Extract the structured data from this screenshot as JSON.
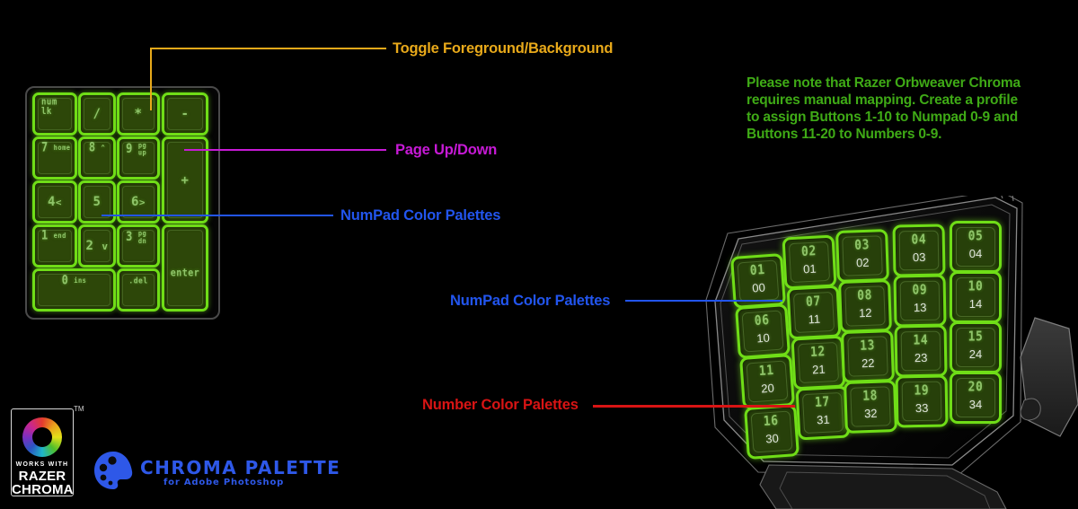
{
  "background": "#000000",
  "note": {
    "color": "#3faa16",
    "lines": [
      "Please note that Razer Orbweaver Chroma",
      "requires manual mapping. Create a profile",
      "to assign Buttons 1-10 to Numpad 0-9 and",
      "Buttons 11-20 to Numbers 0-9."
    ]
  },
  "callouts": [
    {
      "id": "toggle",
      "text": "Toggle Foreground/Background",
      "color": "#e8a91a"
    },
    {
      "id": "pageupdown",
      "text": "Page Up/Down",
      "color": "#c71ad6"
    },
    {
      "id": "numpad_pal",
      "text": "NumPad Color Palettes",
      "color": "#2255ee"
    },
    {
      "id": "numpad_pal2",
      "text": "NumPad Color Palettes",
      "color": "#2255ee"
    },
    {
      "id": "number_pal",
      "text": "Number Color Palettes",
      "color": "#d81414"
    }
  ],
  "numpad": {
    "accent": "#6fdd17",
    "fill": "#2d4709",
    "keys": [
      {
        "id": "numlk",
        "main": "num",
        "sub": "lk",
        "style": "corner2"
      },
      {
        "id": "slash",
        "main": "/",
        "sub": "",
        "style": "corner"
      },
      {
        "id": "star",
        "main": "*",
        "sub": "",
        "style": "center"
      },
      {
        "id": "minus",
        "main": "-",
        "sub": "",
        "style": "center"
      },
      {
        "id": "n7",
        "main": "7",
        "sub": "home",
        "style": "corner"
      },
      {
        "id": "n8",
        "main": "8",
        "sub": "^",
        "style": "corner"
      },
      {
        "id": "n9",
        "main": "9",
        "sub": "pg up",
        "style": "corner2"
      },
      {
        "id": "plus",
        "main": "+",
        "sub": "",
        "style": "center"
      },
      {
        "id": "n4",
        "main": "4",
        "sub": "<",
        "style": "center"
      },
      {
        "id": "n5",
        "main": "5",
        "sub": "",
        "style": "center"
      },
      {
        "id": "n6",
        "main": "6",
        "sub": ">",
        "style": "center"
      },
      {
        "id": "n1",
        "main": "1",
        "sub": "end",
        "style": "corner"
      },
      {
        "id": "n2",
        "main": "2",
        "sub": "v",
        "style": "center"
      },
      {
        "id": "n3",
        "main": "3",
        "sub": "pg dn",
        "style": "corner2"
      },
      {
        "id": "enter",
        "main": "enter",
        "sub": "",
        "style": "centerlow"
      },
      {
        "id": "n0",
        "main": "0",
        "sub": "ins",
        "style": "center"
      },
      {
        "id": "dot",
        "main": ".",
        "sub": "del",
        "style": "corner"
      }
    ]
  },
  "orbweaver": {
    "accent": "#6fdd17",
    "fill": "#27400a",
    "keys": [
      {
        "button": "01",
        "map": "00"
      },
      {
        "button": "02",
        "map": "01"
      },
      {
        "button": "03",
        "map": "02"
      },
      {
        "button": "04",
        "map": "03"
      },
      {
        "button": "05",
        "map": "04"
      },
      {
        "button": "06",
        "map": "10"
      },
      {
        "button": "07",
        "map": "11"
      },
      {
        "button": "08",
        "map": "12"
      },
      {
        "button": "09",
        "map": "13"
      },
      {
        "button": "10",
        "map": "14"
      },
      {
        "button": "11",
        "map": "20"
      },
      {
        "button": "12",
        "map": "21"
      },
      {
        "button": "13",
        "map": "22"
      },
      {
        "button": "14",
        "map": "23"
      },
      {
        "button": "15",
        "map": "24"
      },
      {
        "button": "16",
        "map": "30"
      },
      {
        "button": "17",
        "map": "31"
      },
      {
        "button": "18",
        "map": "32"
      },
      {
        "button": "19",
        "map": "33"
      },
      {
        "button": "20",
        "map": "34"
      }
    ]
  },
  "razer_badge": {
    "line1": "WORKS WITH",
    "line2a": "RAZER",
    "line2b": "CHROMA",
    "trademark": "TM"
  },
  "chroma_palette": {
    "title": "CHROMA PALETTE",
    "subtitle": "for Adobe Photoshop",
    "color": "#2e58e8"
  }
}
